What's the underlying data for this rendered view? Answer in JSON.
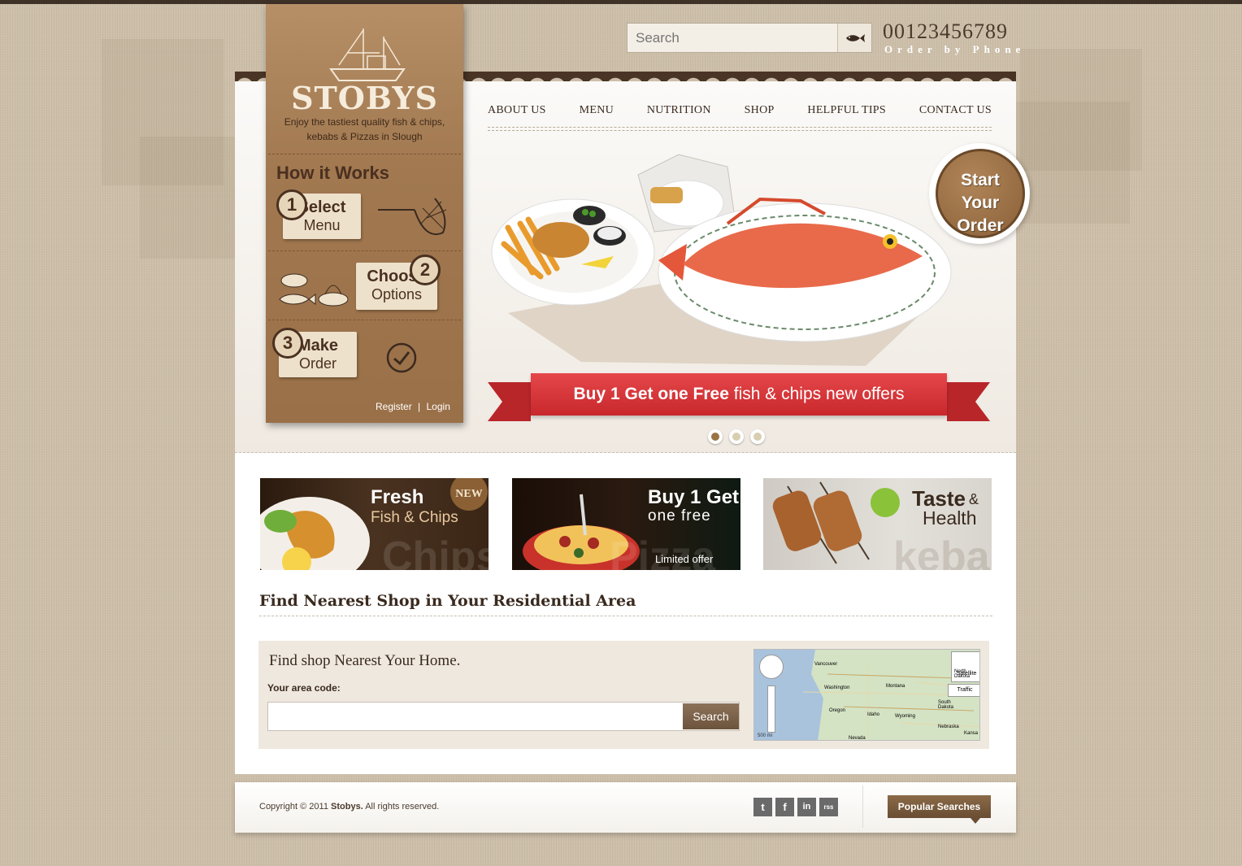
{
  "header": {
    "search_placeholder": "Search",
    "phone_number": "00123456789",
    "phone_caption": "Order by Phone"
  },
  "brand": {
    "logo_text": "STOBYS",
    "tagline_line1": "Enjoy the tastiest quality fish & chips,",
    "tagline_line2": "kebabs & Pizzas in Slough"
  },
  "how_it_works": {
    "title": "How it Works",
    "steps": [
      {
        "number": "1",
        "bold": "Select",
        "text": "Menu"
      },
      {
        "number": "2",
        "bold": "Choose",
        "text": "Options"
      },
      {
        "number": "3",
        "bold": "Make",
        "text": "Order"
      }
    ]
  },
  "auth": {
    "register": "Register",
    "separator": "|",
    "login": "Login"
  },
  "nav": {
    "items": [
      "ABOUT US",
      "MENU",
      "NUTRITION",
      "SHOP",
      "HELPFUL TIPS",
      "CONTACT US"
    ]
  },
  "hero": {
    "cta_line1": "Start",
    "cta_line2": "Your Order",
    "banner_bold": "Buy 1 Get one Free",
    "banner_text": "fish & chips new offers"
  },
  "promos": [
    {
      "title": "Fresh",
      "subtitle": "Fish & Chips",
      "badge": "NEW",
      "watermark": "Chips"
    },
    {
      "title": "Buy 1 Get",
      "subtitle": "one free",
      "note": "Limited offer",
      "watermark": "Pizza"
    },
    {
      "title": "Taste",
      "amp": "&",
      "subtitle": "Health",
      "watermark": "kebabs"
    }
  ],
  "finder": {
    "title": "Find Nearest Shop in Your Residential Area",
    "subtitle": "Find shop Nearest Your Home.",
    "area_label": "Your area code:",
    "search_button": "Search",
    "map": {
      "satellite": "Satellite",
      "traffic": "Traffic",
      "scale": "500 mi",
      "places": [
        "Vancouver",
        "Washington",
        "Montana",
        "North Dakota",
        "Oregon",
        "Idaho",
        "Wyoming",
        "South Dakota",
        "Nebraska",
        "Nevada",
        "Kansa"
      ]
    }
  },
  "footer": {
    "copyright_prefix": "Copyright © 2011",
    "brand": "Stobys.",
    "rights": "All rights reserved.",
    "social": [
      "t",
      "f",
      "in",
      "rss"
    ],
    "popular": "Popular Searches"
  },
  "colors": {
    "accent": "#9a7445",
    "ribbon": "#d7373b",
    "dark": "#4a3425"
  }
}
